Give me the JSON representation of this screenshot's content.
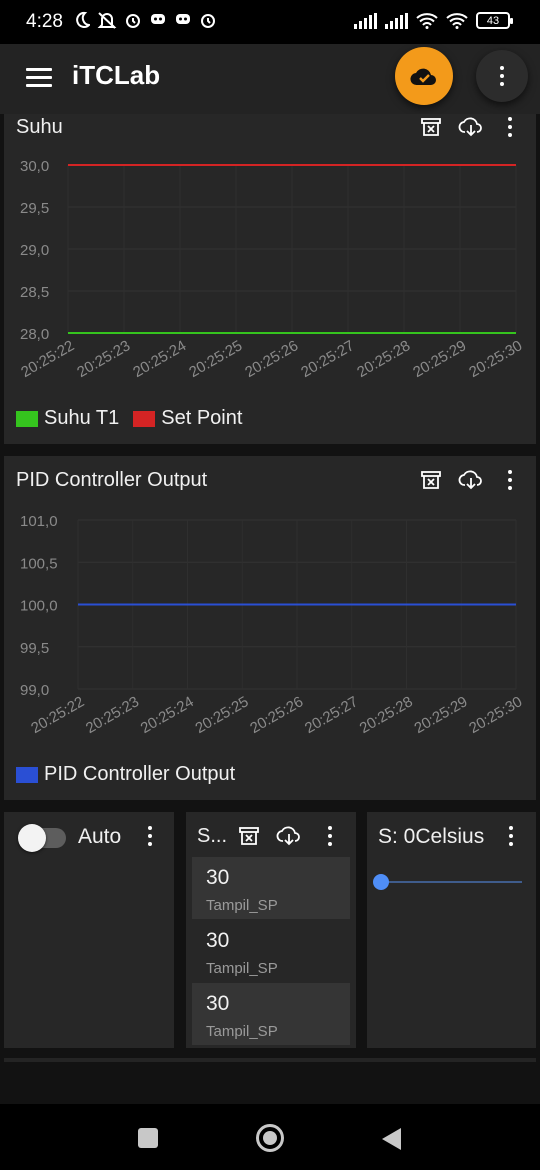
{
  "status_bar": {
    "time": "4:28",
    "battery": "43",
    "left_icons": [
      "moon-icon",
      "muted-bell-icon",
      "alarm-icon",
      "discord-icon",
      "discord-icon",
      "alarm-icon"
    ],
    "right_icons": [
      "signal-icon",
      "signal-icon",
      "wifi-icon",
      "wifi-icon",
      "battery-icon"
    ]
  },
  "app_bar": {
    "title": "iTCLab",
    "menu_icon": "hamburger-menu-icon",
    "cloud_icon": "cloud-check-icon",
    "more_icon": "more-vert-icon",
    "accent": "#f39a1a"
  },
  "charts": {
    "suhu": {
      "title": "Suhu",
      "tools": [
        "archive-clear-icon",
        "cloud-download-icon",
        "more-vert-icon"
      ],
      "legend": [
        "Suhu T1",
        "Set Point"
      ]
    },
    "pid": {
      "title": "PID Controller Output",
      "tools": [
        "archive-clear-icon",
        "cloud-download-icon",
        "more-vert-icon"
      ],
      "legend": [
        "PID Controller Output"
      ]
    }
  },
  "chart_data": [
    {
      "type": "line",
      "title": "Suhu",
      "x": [
        "20:25:22",
        "20:25:23",
        "20:25:24",
        "20:25:25",
        "20:25:26",
        "20:25:27",
        "20:25:28",
        "20:25:29",
        "20:25:30"
      ],
      "series": [
        {
          "name": "Suhu T1",
          "color": "#35c41e",
          "values": [
            28.0,
            28.0,
            28.0,
            28.0,
            28.0,
            28.0,
            28.0,
            28.0,
            28.0
          ]
        },
        {
          "name": "Set Point",
          "color": "#d42424",
          "values": [
            30.0,
            30.0,
            30.0,
            30.0,
            30.0,
            30.0,
            30.0,
            30.0,
            30.0
          ]
        }
      ],
      "yticks": [
        "30,0",
        "29,5",
        "29,0",
        "28,5",
        "28,0"
      ],
      "ylim": [
        28.0,
        30.0
      ],
      "grid": true,
      "legend": "bottom-left"
    },
    {
      "type": "line",
      "title": "PID Controller Output",
      "x": [
        "20:25:22",
        "20:25:23",
        "20:25:24",
        "20:25:25",
        "20:25:26",
        "20:25:27",
        "20:25:28",
        "20:25:29",
        "20:25:30"
      ],
      "series": [
        {
          "name": "PID Controller Output",
          "color": "#2a4fd4",
          "values": [
            100.0,
            100.0,
            100.0,
            100.0,
            100.0,
            100.0,
            100.0,
            100.0,
            100.0
          ]
        }
      ],
      "yticks": [
        "101,0",
        "100,5",
        "100,0",
        "99,5",
        "99,0"
      ],
      "ylim": [
        99.0,
        101.0
      ],
      "grid": true,
      "legend": "bottom-left"
    }
  ],
  "switch_widget": {
    "label": "Auto",
    "on": false,
    "more_icon": "more-vert-icon"
  },
  "list_widget": {
    "title": "S...",
    "tools": [
      "archive-clear-icon",
      "cloud-download-icon",
      "more-vert-icon"
    ],
    "items": [
      {
        "value": "30",
        "label": "Tampil_SP"
      },
      {
        "value": "30",
        "label": "Tampil_SP"
      },
      {
        "value": "30",
        "label": "Tampil_SP"
      }
    ]
  },
  "slider_widget": {
    "label": "S: 0Celsius",
    "value": 0,
    "more_icon": "more-vert-icon"
  },
  "nav_bar": {
    "icons": [
      "recent-apps-icon",
      "home-icon",
      "back-icon"
    ]
  }
}
